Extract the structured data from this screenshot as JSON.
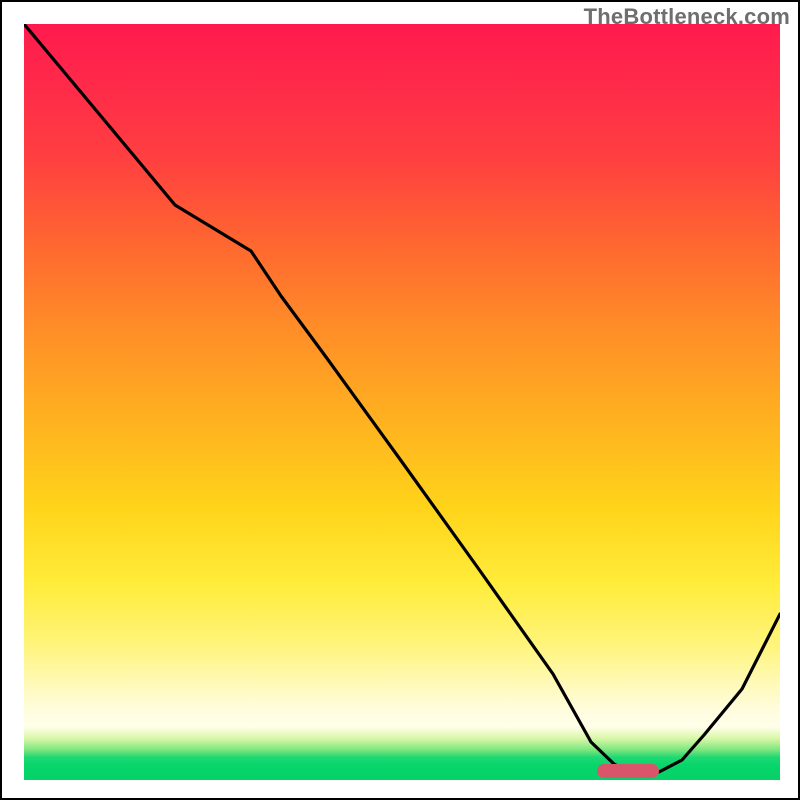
{
  "watermark": "TheBottleneck.com",
  "colors": {
    "curve": "#000000",
    "marker": "#d9566a",
    "frame_border": "#000000"
  },
  "chart_data": {
    "type": "line",
    "title": "",
    "xlabel": "",
    "ylabel": "",
    "xlim": [
      0,
      100
    ],
    "ylim": [
      0,
      100
    ],
    "grid": false,
    "gradient_meaning": "vertical color scale: red (top) = high bottleneck, green (bottom) = optimal",
    "series": [
      {
        "name": "bottleneck-curve",
        "x": [
          0,
          10,
          20,
          30,
          40,
          50,
          60,
          70,
          75,
          80,
          85,
          90,
          100
        ],
        "y": [
          100,
          88,
          76,
          70,
          56,
          42,
          28,
          14,
          5,
          1,
          1,
          6,
          22
        ]
      }
    ],
    "marker": {
      "name": "optimal-range",
      "x_start": 76,
      "x_end": 84,
      "y": 0.5
    }
  }
}
